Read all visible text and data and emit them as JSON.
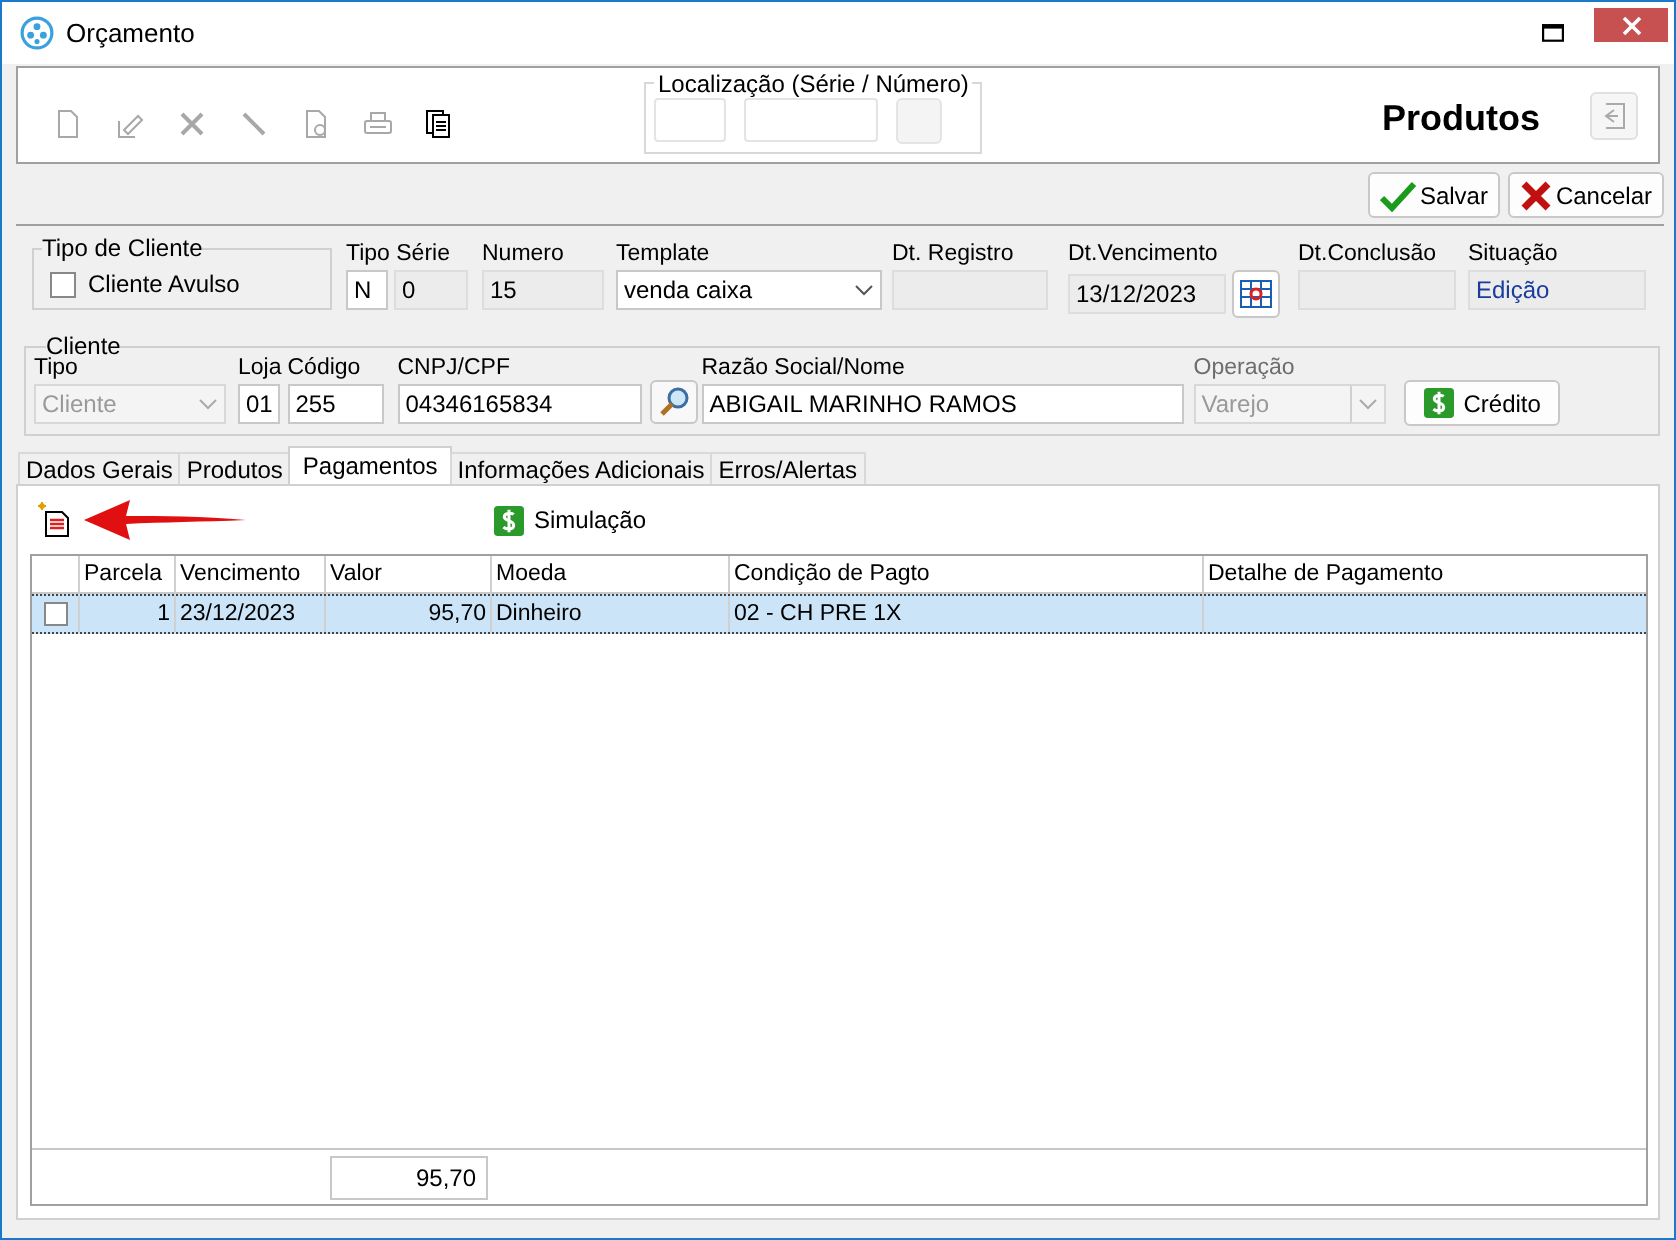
{
  "window": {
    "title": "Orçamento"
  },
  "tools": [
    {
      "kind": "new",
      "disabled": true
    },
    {
      "kind": "edit",
      "disabled": true
    },
    {
      "kind": "delete",
      "disabled": true
    },
    {
      "kind": "pen",
      "disabled": true
    },
    {
      "kind": "preview",
      "disabled": true
    },
    {
      "kind": "print",
      "disabled": true
    },
    {
      "kind": "copy",
      "disabled": false
    }
  ],
  "location": {
    "label": "Localização (Série / Número)"
  },
  "module_title": "Produtos",
  "actions": [
    {
      "kind": "save",
      "label": "Salvar"
    },
    {
      "kind": "cancel",
      "label": "Cancelar"
    }
  ],
  "client_type": {
    "legend": "Tipo de Cliente",
    "label": "Cliente Avulso",
    "checked": false
  },
  "serie": {
    "label": "Tipo Série",
    "type": "N",
    "number": "0"
  },
  "numero": {
    "label": "Numero",
    "value": "15"
  },
  "template": {
    "label": "Template",
    "value": "venda caixa"
  },
  "dt_registro": {
    "label": "Dt. Registro"
  },
  "dt_vencimento": {
    "label": "Dt.Vencimento",
    "value": "13/12/2023"
  },
  "dt_conclusao": {
    "label": "Dt.Conclusão"
  },
  "situacao": {
    "label": "Situação",
    "value": "Edição"
  },
  "cliente": {
    "legend": "Cliente",
    "tipo": {
      "label": "Tipo",
      "value": "Cliente",
      "disabled": true
    },
    "loja": {
      "label": "Loja",
      "value": "01"
    },
    "codigo": {
      "label": "Código",
      "value": "255"
    },
    "cnpj": {
      "label": "CNPJ/CPF",
      "value": "04346165834"
    },
    "razao": {
      "label": "Razão Social/Nome",
      "value": "ABIGAIL MARINHO RAMOS"
    },
    "operacao": {
      "label": "Operação",
      "value": "Varejo",
      "disabled": true
    },
    "credit_button": "Crédito"
  },
  "tabs": [
    {
      "label": "Dados Gerais",
      "selected": false
    },
    {
      "label": "Produtos",
      "selected": false
    },
    {
      "label": "Pagamentos",
      "selected": true
    },
    {
      "label": "Informações Adicionais",
      "selected": false
    },
    {
      "label": "Erros/Alertas",
      "selected": false
    }
  ],
  "payments": {
    "simulation_button": "Simulação",
    "columns": [
      "Parcela",
      "Vencimento",
      "Valor",
      "Moeda",
      "Condição de Pagto",
      "Detalhe de Pagamento"
    ],
    "rows": [
      {
        "checked": false,
        "selected": true,
        "parcela": "1",
        "vencimento": "23/12/2023",
        "valor": "95,70",
        "moeda": "Dinheiro",
        "condicao": "02 - CH PRE 1X"
      }
    ],
    "total": "95,70"
  }
}
